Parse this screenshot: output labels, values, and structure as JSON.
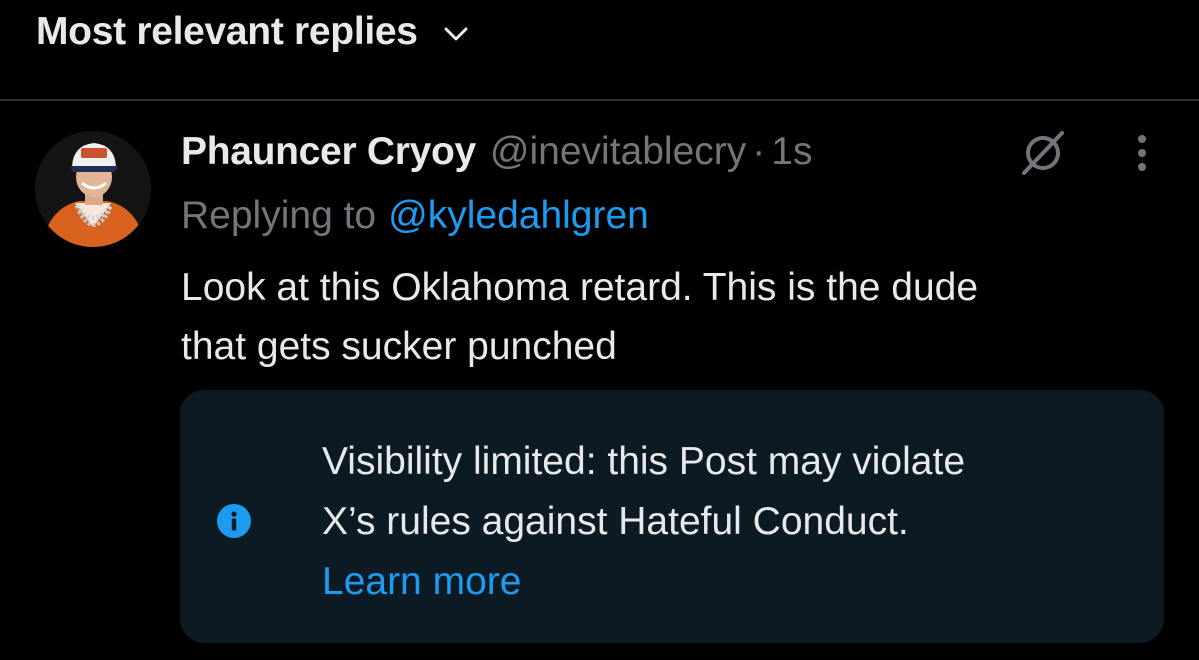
{
  "sort": {
    "label": "Most relevant replies",
    "icon": "chevron-down-icon"
  },
  "post": {
    "display_name": "Phauncer Cryoy",
    "handle": "@inevitablecry",
    "separator": "·",
    "time": "1s",
    "replying_prefix": "Replying to",
    "replying_to": "@kyledahlgren",
    "body_lines": [
      "Look at this Oklahoma retard. This is the dude",
      "that gets sucker punched"
    ],
    "icons": [
      "grok-icon",
      "more-vertical-icon"
    ]
  },
  "notice": {
    "lines": [
      "Visibility limited: this Post may violate",
      "X’s rules against Hateful Conduct."
    ],
    "link": "Learn more",
    "icon": "info-icon"
  },
  "colors": {
    "background": "#000000",
    "text": "#e7e9ea",
    "secondary": "#71767b",
    "accent": "#1d9bf0",
    "notice_background": "#0c1a24",
    "divider": "#2f3336"
  }
}
